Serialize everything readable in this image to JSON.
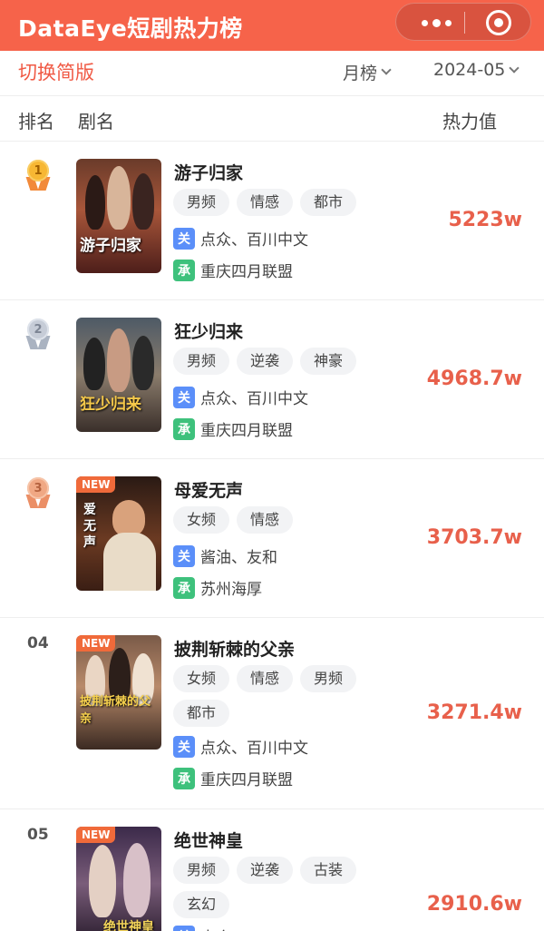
{
  "header": {
    "title": "DataEye短剧热力榜"
  },
  "capsule": {
    "more_icon": "more-dots-icon",
    "close_icon": "target-close-icon"
  },
  "filters": {
    "simple_toggle": "切换简版",
    "period": "月榜",
    "date": "2024-05"
  },
  "columns": {
    "rank": "排名",
    "name": "剧名",
    "heat": "热力值"
  },
  "dramas": [
    {
      "rank": "1",
      "rank_style": "gold",
      "name": "游子归家",
      "tags": [
        "男频",
        "情感",
        "都市"
      ],
      "publisher_badge": "关",
      "publisher": "点众、百川中文",
      "producer_badge": "承",
      "producer": "重庆四月联盟",
      "heat": "5223w",
      "is_new": false,
      "poster_text": "游子归家"
    },
    {
      "rank": "2",
      "rank_style": "silver",
      "name": "狂少归来",
      "tags": [
        "男频",
        "逆袭",
        "神豪"
      ],
      "publisher_badge": "关",
      "publisher": "点众、百川中文",
      "producer_badge": "承",
      "producer": "重庆四月联盟",
      "heat": "4968.7w",
      "is_new": false,
      "poster_text": "狂少归来"
    },
    {
      "rank": "3",
      "rank_style": "bronze",
      "name": "母爱无声",
      "tags": [
        "女频",
        "情感"
      ],
      "publisher_badge": "关",
      "publisher": "酱油、友和",
      "producer_badge": "承",
      "producer": "苏州海厚",
      "heat": "3703.7w",
      "is_new": true,
      "new_label": "NEW",
      "poster_text": "爱无声"
    },
    {
      "rank": "04",
      "rank_style": "number",
      "name": "披荆斩棘的父亲",
      "tags": [
        "女频",
        "情感",
        "男频",
        "都市"
      ],
      "publisher_badge": "关",
      "publisher": "点众、百川中文",
      "producer_badge": "承",
      "producer": "重庆四月联盟",
      "heat": "3271.4w",
      "is_new": true,
      "new_label": "NEW",
      "poster_text": "披荆斩棘的父亲"
    },
    {
      "rank": "05",
      "rank_style": "number",
      "name": "绝世神皇",
      "tags": [
        "男频",
        "逆袭",
        "古装",
        "玄幻"
      ],
      "publisher_badge": "关",
      "publisher": "点众",
      "heat": "2910.6w",
      "is_new": true,
      "new_label": "NEW",
      "poster_text": "绝世神皇"
    }
  ]
}
